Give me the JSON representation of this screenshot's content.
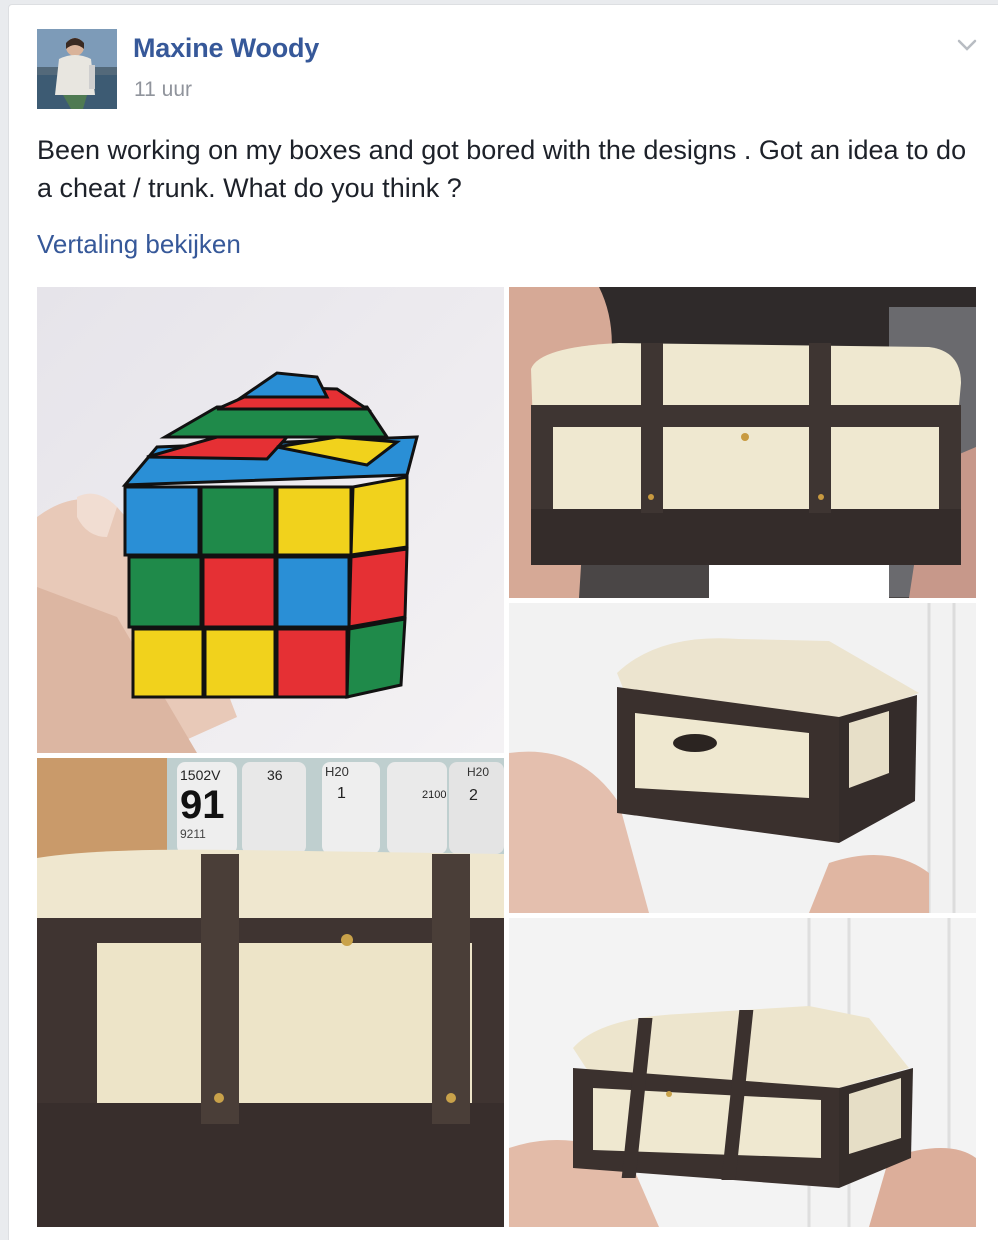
{
  "post": {
    "author": "Maxine Woody",
    "timestamp": "11 uur",
    "text": "Been working on my boxes and got bored with the designs . Got an idea to do a cheat / trunk. What do you think ?",
    "translate_link": "Vertaling bekijken",
    "menu_icon": "chevron-down-icon"
  },
  "photos": [
    {
      "subject": "rubik-cube-bead-box-photo"
    },
    {
      "subject": "trunk-front-photo"
    },
    {
      "subject": "trunk-side-photo"
    },
    {
      "subject": "trunk-closeup-photo"
    },
    {
      "subject": "trunk-angle-photo"
    }
  ],
  "bead_labels": [
    "1502V",
    "91",
    "9211",
    "36",
    "H20",
    "1",
    "2100",
    "H20",
    "2"
  ],
  "colors": {
    "link": "#365899",
    "secondary_text": "#90949c",
    "body_text": "#1d2129",
    "background": "#e9ebee"
  }
}
